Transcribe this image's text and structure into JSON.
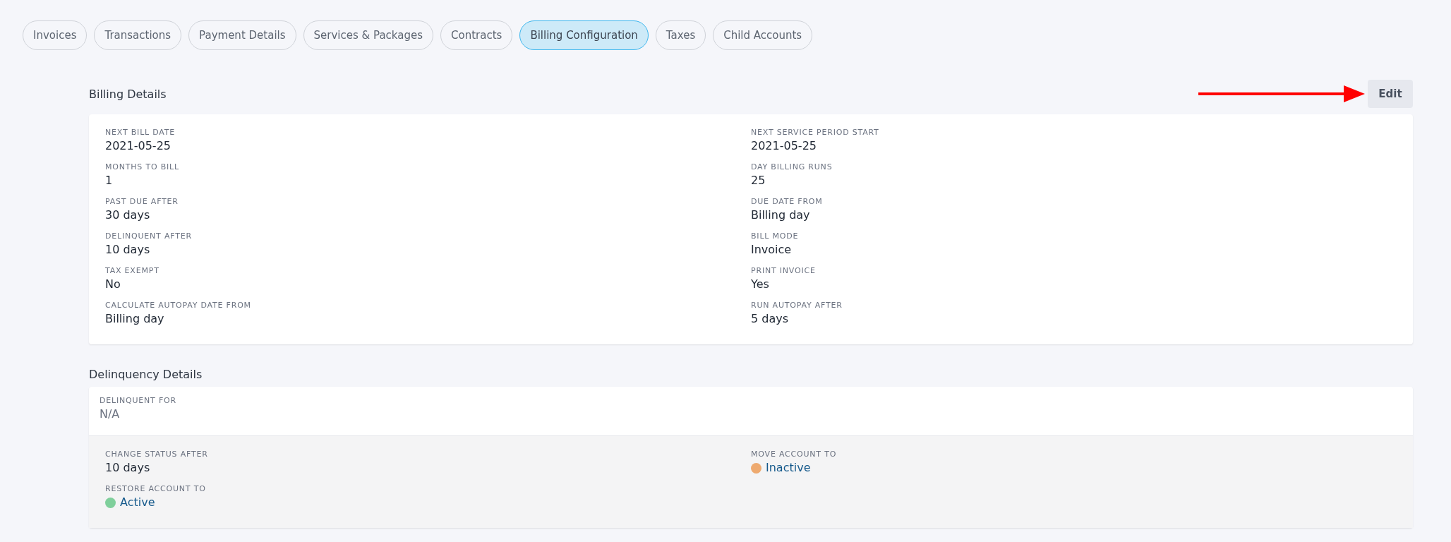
{
  "tabs": [
    {
      "label": "Invoices",
      "selected": false
    },
    {
      "label": "Transactions",
      "selected": false
    },
    {
      "label": "Payment Details",
      "selected": false
    },
    {
      "label": "Services & Packages",
      "selected": false
    },
    {
      "label": "Contracts",
      "selected": false
    },
    {
      "label": "Billing Configuration",
      "selected": true
    },
    {
      "label": "Taxes",
      "selected": false
    },
    {
      "label": "Child Accounts",
      "selected": false
    }
  ],
  "billing_details": {
    "title": "Billing Details",
    "edit_button": "Edit",
    "left": [
      {
        "label": "NEXT BILL DATE",
        "value": "2021-05-25"
      },
      {
        "label": "MONTHS TO BILL",
        "value": "1"
      },
      {
        "label": "PAST DUE AFTER",
        "value": "30 days"
      },
      {
        "label": "DELINQUENT AFTER",
        "value": "10 days"
      },
      {
        "label": "TAX EXEMPT",
        "value": "No"
      },
      {
        "label": "CALCULATE AUTOPAY DATE FROM",
        "value": "Billing day"
      }
    ],
    "right": [
      {
        "label": "NEXT SERVICE PERIOD START",
        "value": "2021-05-25"
      },
      {
        "label": "DAY BILLING RUNS",
        "value": "25"
      },
      {
        "label": "DUE DATE FROM",
        "value": "Billing day"
      },
      {
        "label": "BILL MODE",
        "value": "Invoice"
      },
      {
        "label": "PRINT INVOICE",
        "value": "Yes"
      },
      {
        "label": "RUN AUTOPAY AFTER",
        "value": "5 days"
      }
    ]
  },
  "delinquency_details": {
    "title": "Delinquency Details",
    "delinquent_for": {
      "label": "DELINQUENT FOR",
      "value": "N/A"
    },
    "left": [
      {
        "label": "CHANGE STATUS AFTER",
        "value": "10 days",
        "kind": "text"
      },
      {
        "label": "RESTORE ACCOUNT TO",
        "value": "Active",
        "kind": "status",
        "color": "#7fcf9b"
      }
    ],
    "right": [
      {
        "label": "MOVE ACCOUNT TO",
        "value": "Inactive",
        "kind": "status",
        "color": "#eeaa70"
      }
    ]
  }
}
